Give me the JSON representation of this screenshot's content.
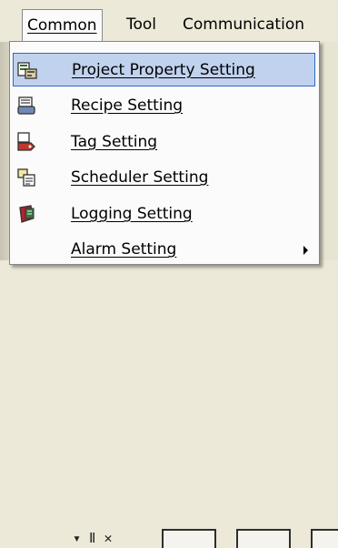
{
  "menubar": {
    "items": [
      {
        "label": "Common"
      },
      {
        "label": "Tool"
      },
      {
        "label": "Communication"
      }
    ]
  },
  "dropdown": {
    "items": [
      {
        "label": "Project Property Setting",
        "icon": "project-property-icon",
        "highlighted": true
      },
      {
        "label": "Recipe Setting",
        "icon": "recipe-icon"
      },
      {
        "label": "Tag Setting",
        "icon": "tag-icon"
      },
      {
        "label": "Scheduler Setting",
        "icon": "scheduler-icon"
      },
      {
        "label": "Logging Setting",
        "icon": "logging-icon"
      },
      {
        "label": "Alarm Setting",
        "icon": "submenu-arrow-icon",
        "has_submenu": true
      }
    ]
  },
  "colors": {
    "highlight_bg": "#c1d2ee",
    "highlight_border": "#316ac5",
    "menu_bg": "#fbfbfb",
    "window_bg": "#ece9d8"
  }
}
